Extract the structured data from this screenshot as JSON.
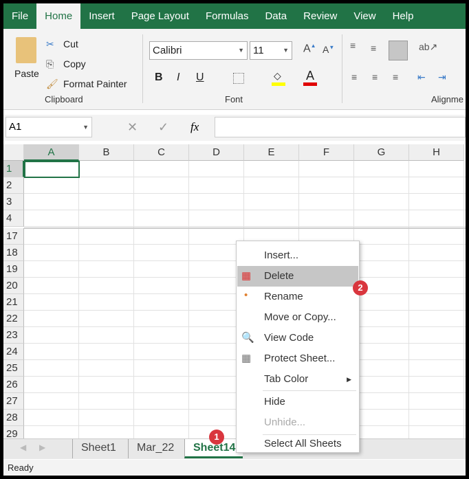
{
  "tabs": [
    "File",
    "Home",
    "Insert",
    "Page Layout",
    "Formulas",
    "Data",
    "Review",
    "View",
    "Help"
  ],
  "clipboard": {
    "paste": "Paste",
    "cut": "Cut",
    "copy": "Copy",
    "format_painter": "Format Painter",
    "group": "Clipboard"
  },
  "font": {
    "name": "Calibri",
    "size": "11",
    "bold": "B",
    "italic": "I",
    "underline": "U",
    "group": "Font",
    "fill_color": "#ffff00",
    "font_color": "#e00000",
    "font_color_glyph": "A"
  },
  "alignment": {
    "group": "Alignme"
  },
  "formula_bar": {
    "name_box": "A1",
    "fx": "fx",
    "value": ""
  },
  "columns": [
    "A",
    "B",
    "C",
    "D",
    "E",
    "F",
    "G",
    "H"
  ],
  "rows": [
    "1",
    "2",
    "3",
    "4",
    "17",
    "18",
    "19",
    "20",
    "21",
    "22",
    "23",
    "24",
    "25",
    "26",
    "27",
    "28",
    "29"
  ],
  "sheets": [
    "Sheet1",
    "Mar_22",
    "Sheet14"
  ],
  "active_sheet": "Sheet14",
  "status": "Ready",
  "context_menu": {
    "items": [
      "Insert...",
      "Delete",
      "Rename",
      "Move or Copy...",
      "View Code",
      "Protect Sheet...",
      "Tab Color",
      "Hide",
      "Unhide...",
      "Select All Sheets"
    ]
  },
  "badges": [
    "1",
    "2"
  ]
}
